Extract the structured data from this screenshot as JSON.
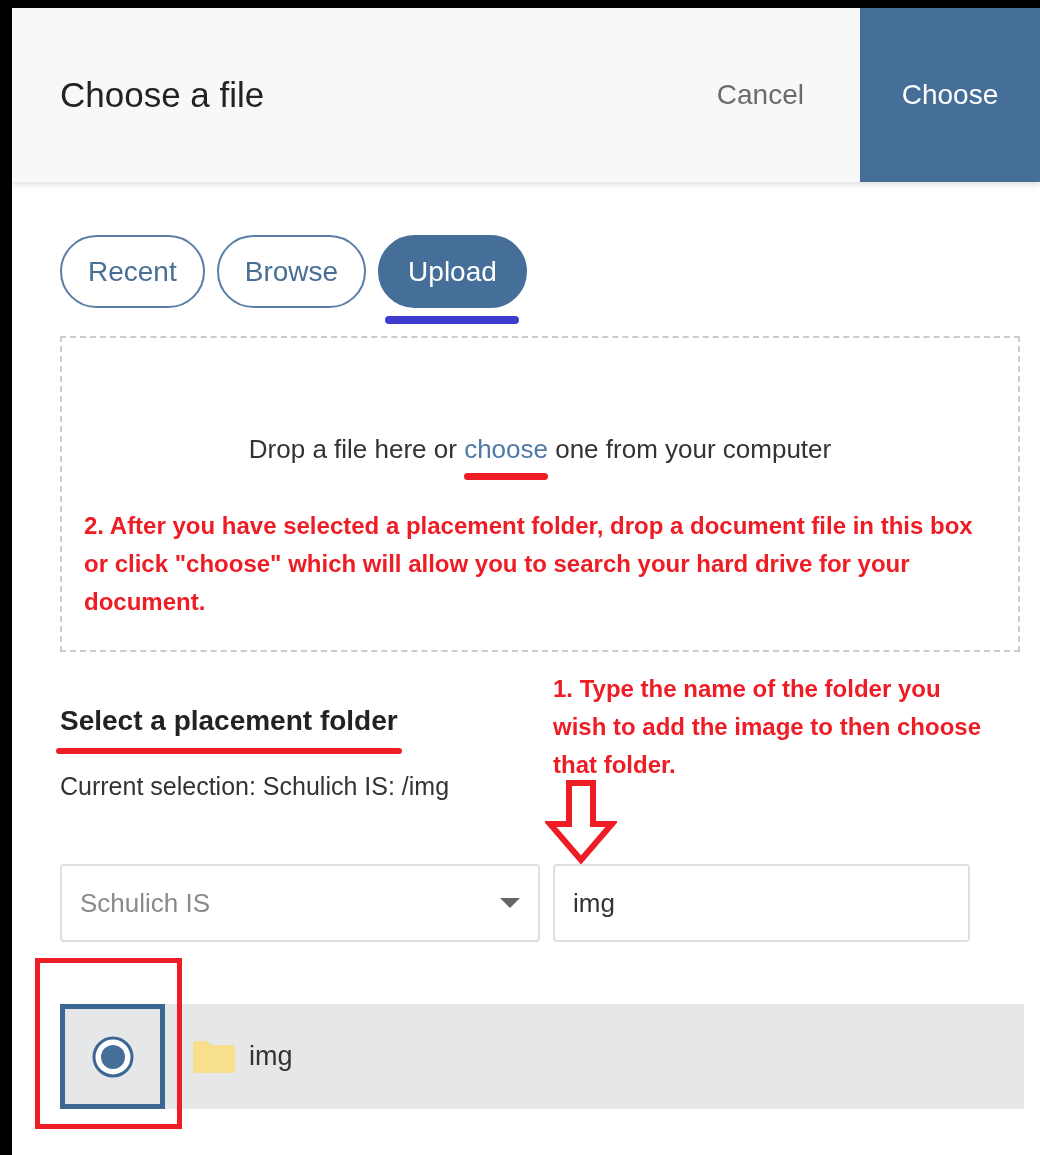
{
  "dialog": {
    "title": "Choose a file",
    "cancel": "Cancel",
    "confirm": "Choose"
  },
  "tabs": [
    {
      "label": "Recent",
      "selected": false
    },
    {
      "label": "Browse",
      "selected": false
    },
    {
      "label": "Upload",
      "selected": true
    }
  ],
  "dropzone": {
    "text_before": "Drop a file here or",
    "link": "choose",
    "text_after": "one from your computer",
    "note": "2. After you have selected a placement folder, drop a document file in this box or click \"choose\" which will allow you to search your hard drive for your document."
  },
  "folder_section": {
    "heading": "Select a placement folder",
    "current_selection": "Current selection: Schulich IS: /img",
    "note": "1.  Type the name of the folder you wish to add the image to then choose that folder.",
    "repository_select": {
      "value": "Schulich IS"
    },
    "search_field": {
      "value": "img"
    },
    "results": [
      {
        "name": "img",
        "selected": true
      }
    ]
  }
}
